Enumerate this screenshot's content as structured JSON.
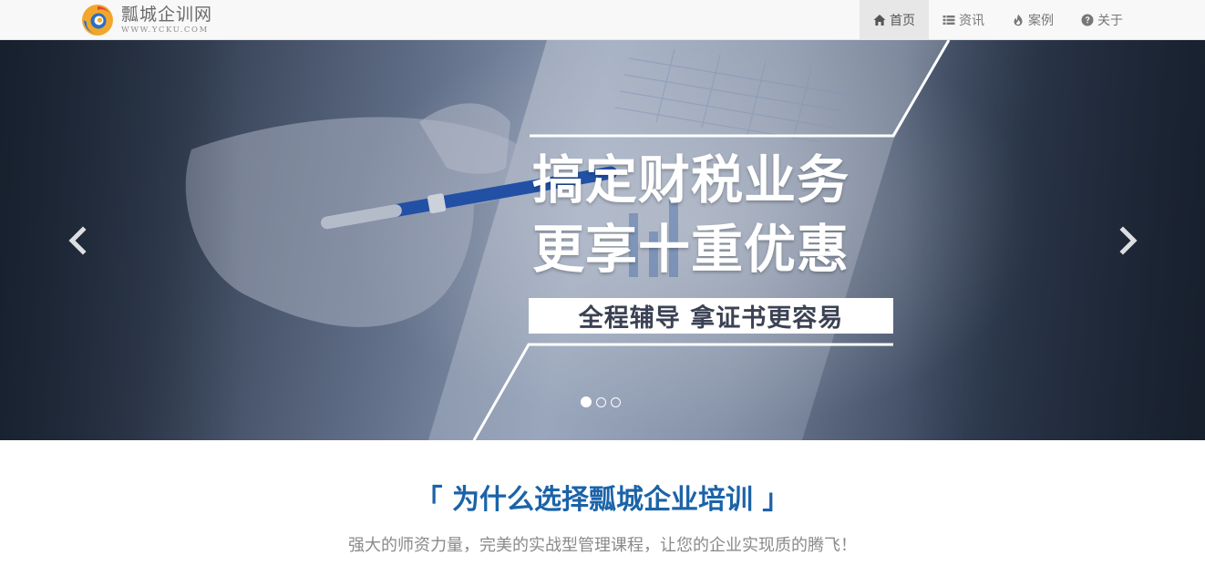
{
  "brand": {
    "name": "瓢城企训网",
    "url": "WWW.YCKU.COM"
  },
  "nav": {
    "items": [
      {
        "label": "首页",
        "icon": "home-icon",
        "active": true
      },
      {
        "label": "资讯",
        "icon": "list-icon",
        "active": false
      },
      {
        "label": "案例",
        "icon": "fire-icon",
        "active": false
      },
      {
        "label": "关于",
        "icon": "question-circle-icon",
        "active": false
      }
    ]
  },
  "hero": {
    "headline_line1": "搞定财税业务",
    "headline_line2": "更享十重优惠",
    "subline": "全程辅导 拿证书更容易",
    "prev_icon": "chevron-left-icon",
    "next_icon": "chevron-right-icon",
    "slide_count": 3,
    "active_slide": 1
  },
  "intro": {
    "title": "「 为什么选择瓢城企业培训 」",
    "subtitle": "强大的师资力量，完美的实战型管理课程，让您的企业实现质的腾飞！"
  },
  "colors": {
    "accent": "#1b63a8",
    "nav_bg": "#f8f8f8",
    "nav_active_bg": "#e7e7e7",
    "hero_dark": "#1f2a3b",
    "subtitle_gray": "#8a8a8a"
  }
}
